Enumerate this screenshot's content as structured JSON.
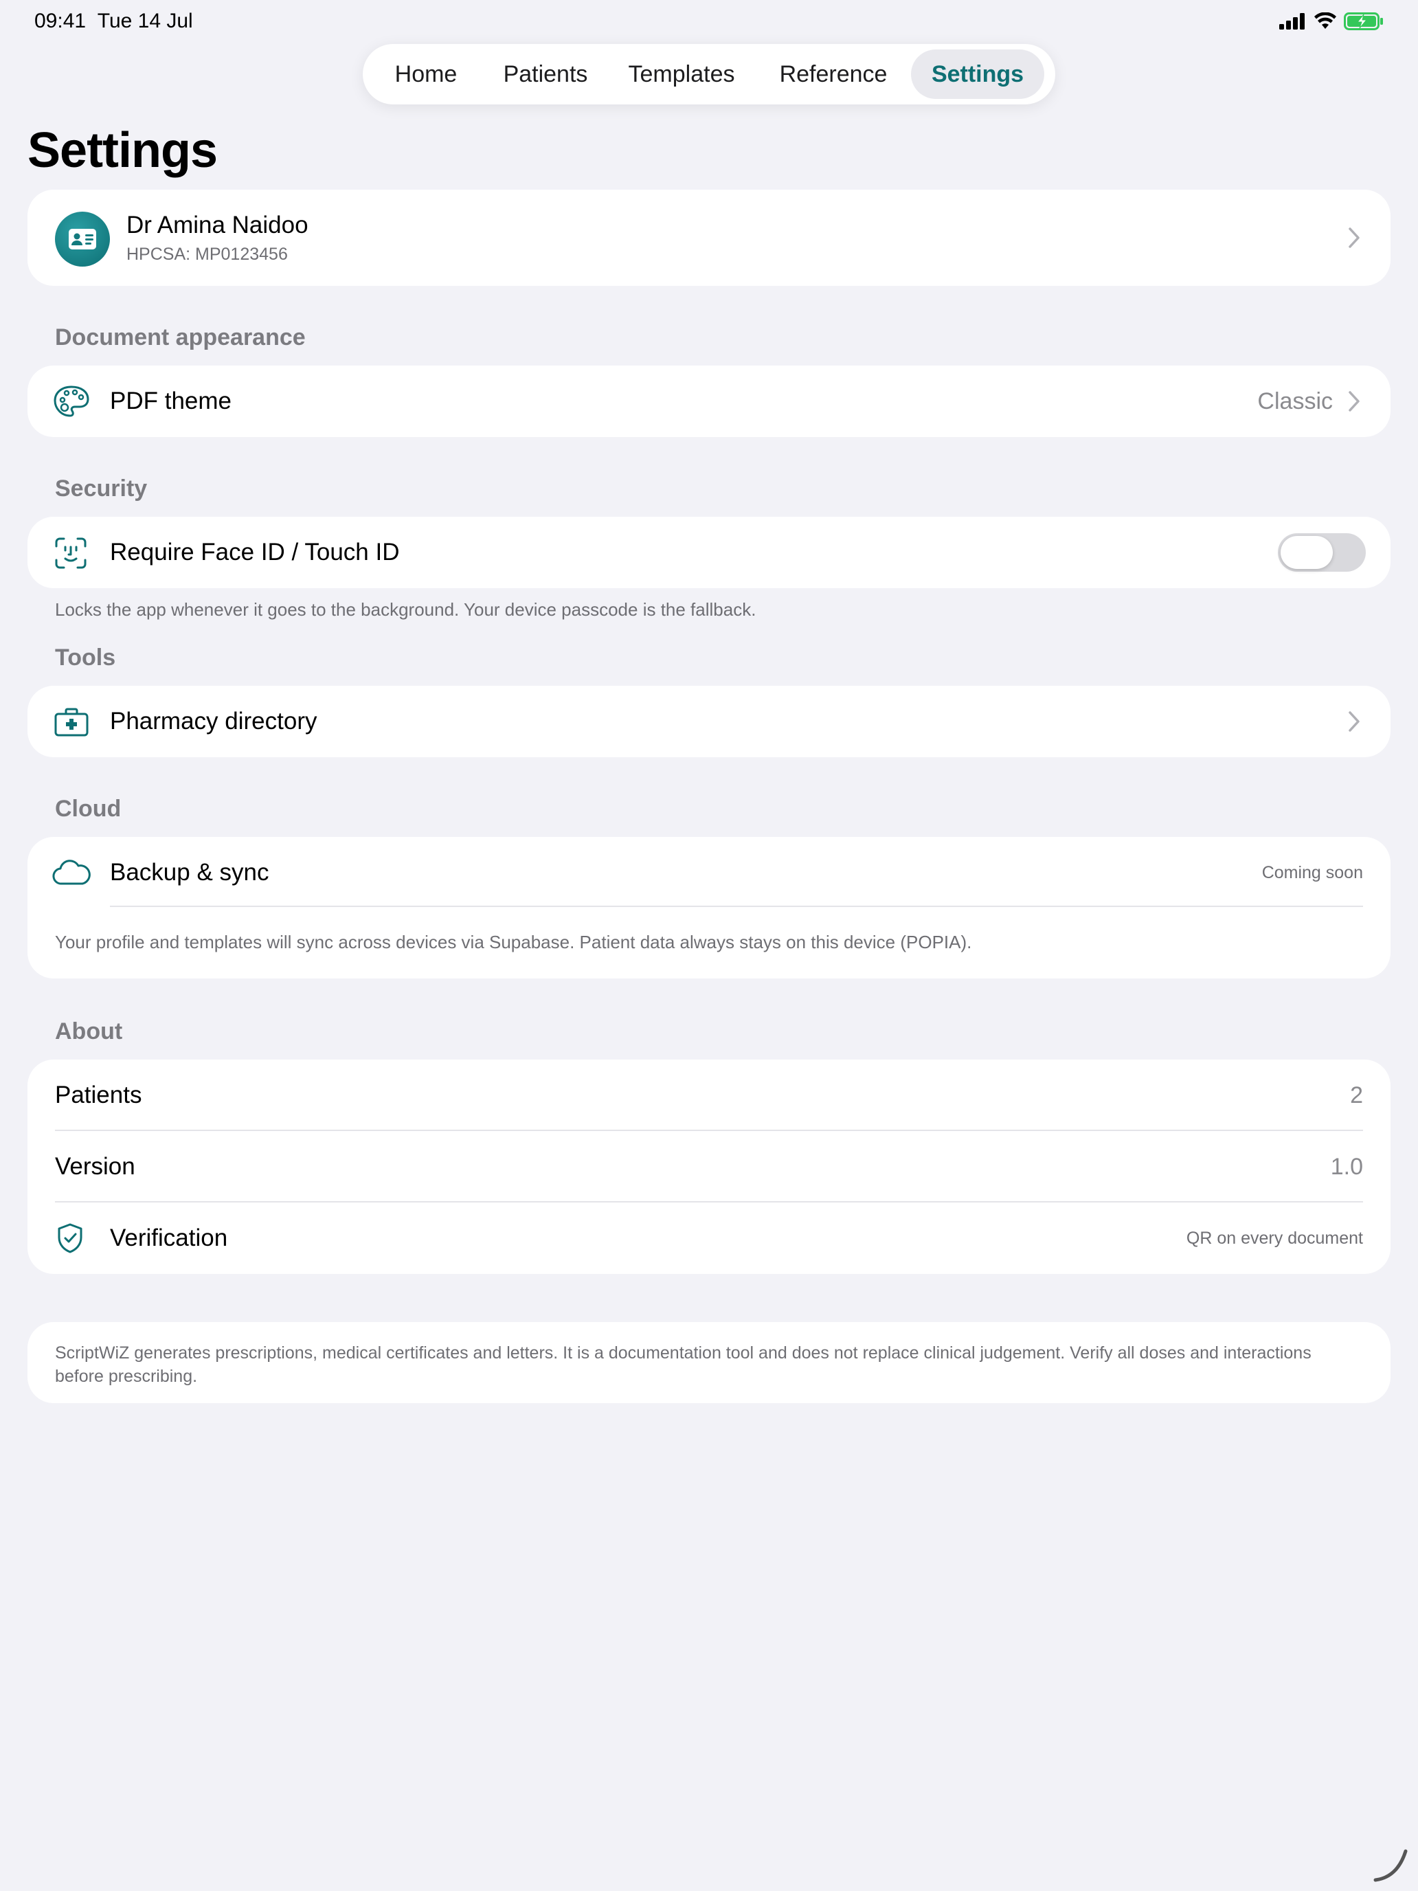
{
  "status_bar": {
    "time": "09:41",
    "date": "Tue 14 Jul"
  },
  "tabs": [
    {
      "label": "Home",
      "active": false
    },
    {
      "label": "Patients",
      "active": false
    },
    {
      "label": "Templates",
      "active": false
    },
    {
      "label": "Reference",
      "active": false
    },
    {
      "label": "Settings",
      "active": true
    }
  ],
  "page_title": "Settings",
  "profile": {
    "name": "Dr Amina Naidoo",
    "registration": "HPCSA: MP0123456"
  },
  "document_appearance": {
    "header": "Document appearance",
    "pdf_theme_label": "PDF theme",
    "pdf_theme_value": "Classic"
  },
  "security": {
    "header": "Security",
    "face_id_label": "Require Face ID / Touch ID",
    "face_id_enabled": false,
    "footnote": "Locks the app whenever it goes to the background. Your device passcode is the fallback."
  },
  "tools": {
    "header": "Tools",
    "pharmacy_label": "Pharmacy directory"
  },
  "cloud": {
    "header": "Cloud",
    "backup_label": "Backup & sync",
    "backup_status": "Coming soon",
    "backup_note": "Your profile and templates will sync across devices via Supabase. Patient data always stays on this device (POPIA)."
  },
  "about": {
    "header": "About",
    "patients_label": "Patients",
    "patients_value": "2",
    "version_label": "Version",
    "version_value": "1.0",
    "verification_label": "Verification",
    "verification_value": "QR on every document"
  },
  "disclaimer": "ScriptWiZ generates prescriptions, medical certificates and letters. It is a documentation tool and does not replace clinical judgement. Verify all doses and interactions before prescribing.",
  "colors": {
    "accent": "#0e6f73",
    "background": "#f2f2f7",
    "battery": "#34c759"
  },
  "icons": {
    "profile": "id-card-icon",
    "pdf_theme": "palette-icon",
    "face_id": "face-id-icon",
    "pharmacy": "medical-kit-icon",
    "backup": "cloud-icon",
    "verification": "shield-check-icon"
  }
}
